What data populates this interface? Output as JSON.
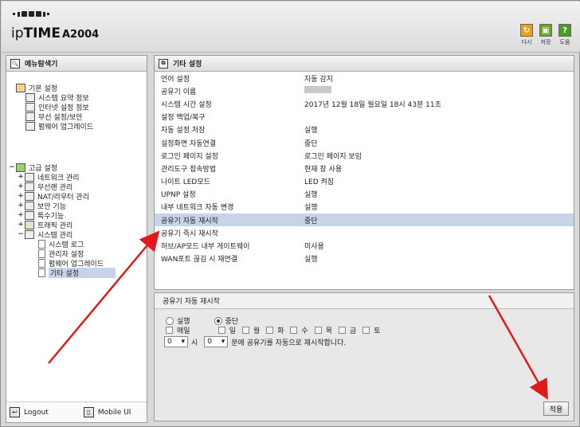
{
  "header": {
    "brand_prefix": "ip",
    "brand_main": "TIME",
    "model": "A2004",
    "buttons": [
      {
        "label": "다시",
        "icon": "refresh-icon",
        "color": "#e8a020"
      },
      {
        "label": "저장",
        "icon": "save-icon",
        "color": "#6aa820"
      },
      {
        "label": "도움",
        "icon": "help-icon",
        "color": "#4c9a2a"
      }
    ]
  },
  "left": {
    "title": "메뉴탐색기",
    "basic": {
      "label": "기본 설정",
      "items": [
        "시스템 요약 정보",
        "인터넷 설정 정보",
        "무선 설정/보안",
        "펌웨어 업그레이드"
      ]
    },
    "advanced": {
      "label": "고급 설정",
      "items": [
        "네트워크 관리",
        "무선랜 관리",
        "NAT/라우터 관리",
        "보안 기능",
        "특수기능",
        "트래픽 관리",
        "시스템 관리"
      ],
      "system_items": [
        "시스템 로그",
        "관리자 설정",
        "펌웨어 업그레이드",
        "기타 설정"
      ]
    },
    "footer": {
      "logout": "Logout",
      "mobile": "Mobile UI"
    }
  },
  "main": {
    "title": "기타 설정",
    "rows": [
      {
        "k": "언어 설정",
        "v": "자동 감지"
      },
      {
        "k": "공유기 이름",
        "v": ""
      },
      {
        "k": "시스템 시간 설정",
        "v": "2017년 12월 18일 월요일 18시 43분 11초"
      },
      {
        "k": "설정 백업/복구",
        "v": ""
      },
      {
        "k": "자동 설정 저장",
        "v": "실행"
      },
      {
        "k": "설정화면 자동연결",
        "v": "중단"
      },
      {
        "k": "로그인 페이지 설정",
        "v": "로그인 페이지 보임"
      },
      {
        "k": "관리도구 접속방법",
        "v": "현재 창 사용"
      },
      {
        "k": "나이트 LED모드",
        "v": "LED 켜짐"
      },
      {
        "k": "UPNP 설정",
        "v": "실행"
      },
      {
        "k": "내부 네트워크 자동 변경",
        "v": "실행"
      },
      {
        "k": "공유기 자동 재시작",
        "v": "중단"
      },
      {
        "k": "공유기 즉시 재시작",
        "v": ""
      },
      {
        "k": "허브/AP모드 내부 게이트웨이",
        "v": "미사용"
      },
      {
        "k": "WAN포트 끊김 시 재연결",
        "v": "실행"
      }
    ]
  },
  "restart": {
    "title": "공유기 자동 재시작",
    "run": "실행",
    "stop": "중단",
    "daily": "매일",
    "days": [
      "일",
      "월",
      "화",
      "수",
      "목",
      "금",
      "토"
    ],
    "hour_value": "0",
    "hour_unit": "시",
    "min_value": "0",
    "min_suffix": "분에 공유기를 자동으로 재시작합니다.",
    "apply": "적용"
  }
}
